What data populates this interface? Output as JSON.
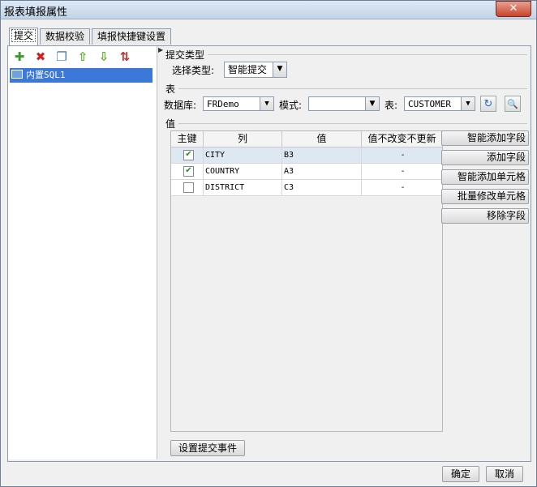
{
  "window": {
    "title": "报表填报属性",
    "close_symbol": "✕"
  },
  "tabs": [
    {
      "label": "提交",
      "active": true
    },
    {
      "label": "数据校验",
      "active": false
    },
    {
      "label": "填报快捷键设置",
      "active": false
    }
  ],
  "toolbar": {
    "icons": [
      "add-icon",
      "delete-icon",
      "copy-icon",
      "move-up-icon",
      "move-down-icon",
      "sort-icon"
    ],
    "glyphs": {
      "add": "✚",
      "delete": "✖",
      "copy": "❐",
      "up": "⇧",
      "down": "⇩",
      "sort": "⇅"
    }
  },
  "tree": {
    "items": [
      {
        "label": "内置SQL1",
        "selected": true
      }
    ]
  },
  "submit_type": {
    "section_title": "提交类型",
    "label": "选择类型:",
    "value": "智能提交"
  },
  "table_section": {
    "section_title": "表",
    "database_label": "数据库:",
    "database_value": "FRDemo",
    "schema_label": "模式:",
    "schema_value": "",
    "table_label": "表:",
    "table_value": "CUSTOMER",
    "refresh_glyph": "↻",
    "preview_glyph": "🔍"
  },
  "value_section": {
    "section_title": "值",
    "columns": [
      "主键",
      "列",
      "值",
      "值不改变不更新"
    ],
    "rows": [
      {
        "key": true,
        "column": "CITY",
        "value": "B3",
        "no_update": "-",
        "selected": true
      },
      {
        "key": true,
        "column": "COUNTRY",
        "value": "A3",
        "no_update": "-",
        "selected": false
      },
      {
        "key": false,
        "column": "DISTRICT",
        "value": "C3",
        "no_update": "-",
        "selected": false
      }
    ],
    "buttons": [
      "智能添加字段",
      "添加字段",
      "智能添加单元格",
      "批量修改单元格",
      "移除字段"
    ],
    "event_button": "设置提交事件"
  },
  "footer": {
    "ok": "确定",
    "cancel": "取消"
  },
  "colors": {
    "accent": "#3b78d8",
    "selected_row": "#dde8f3"
  }
}
